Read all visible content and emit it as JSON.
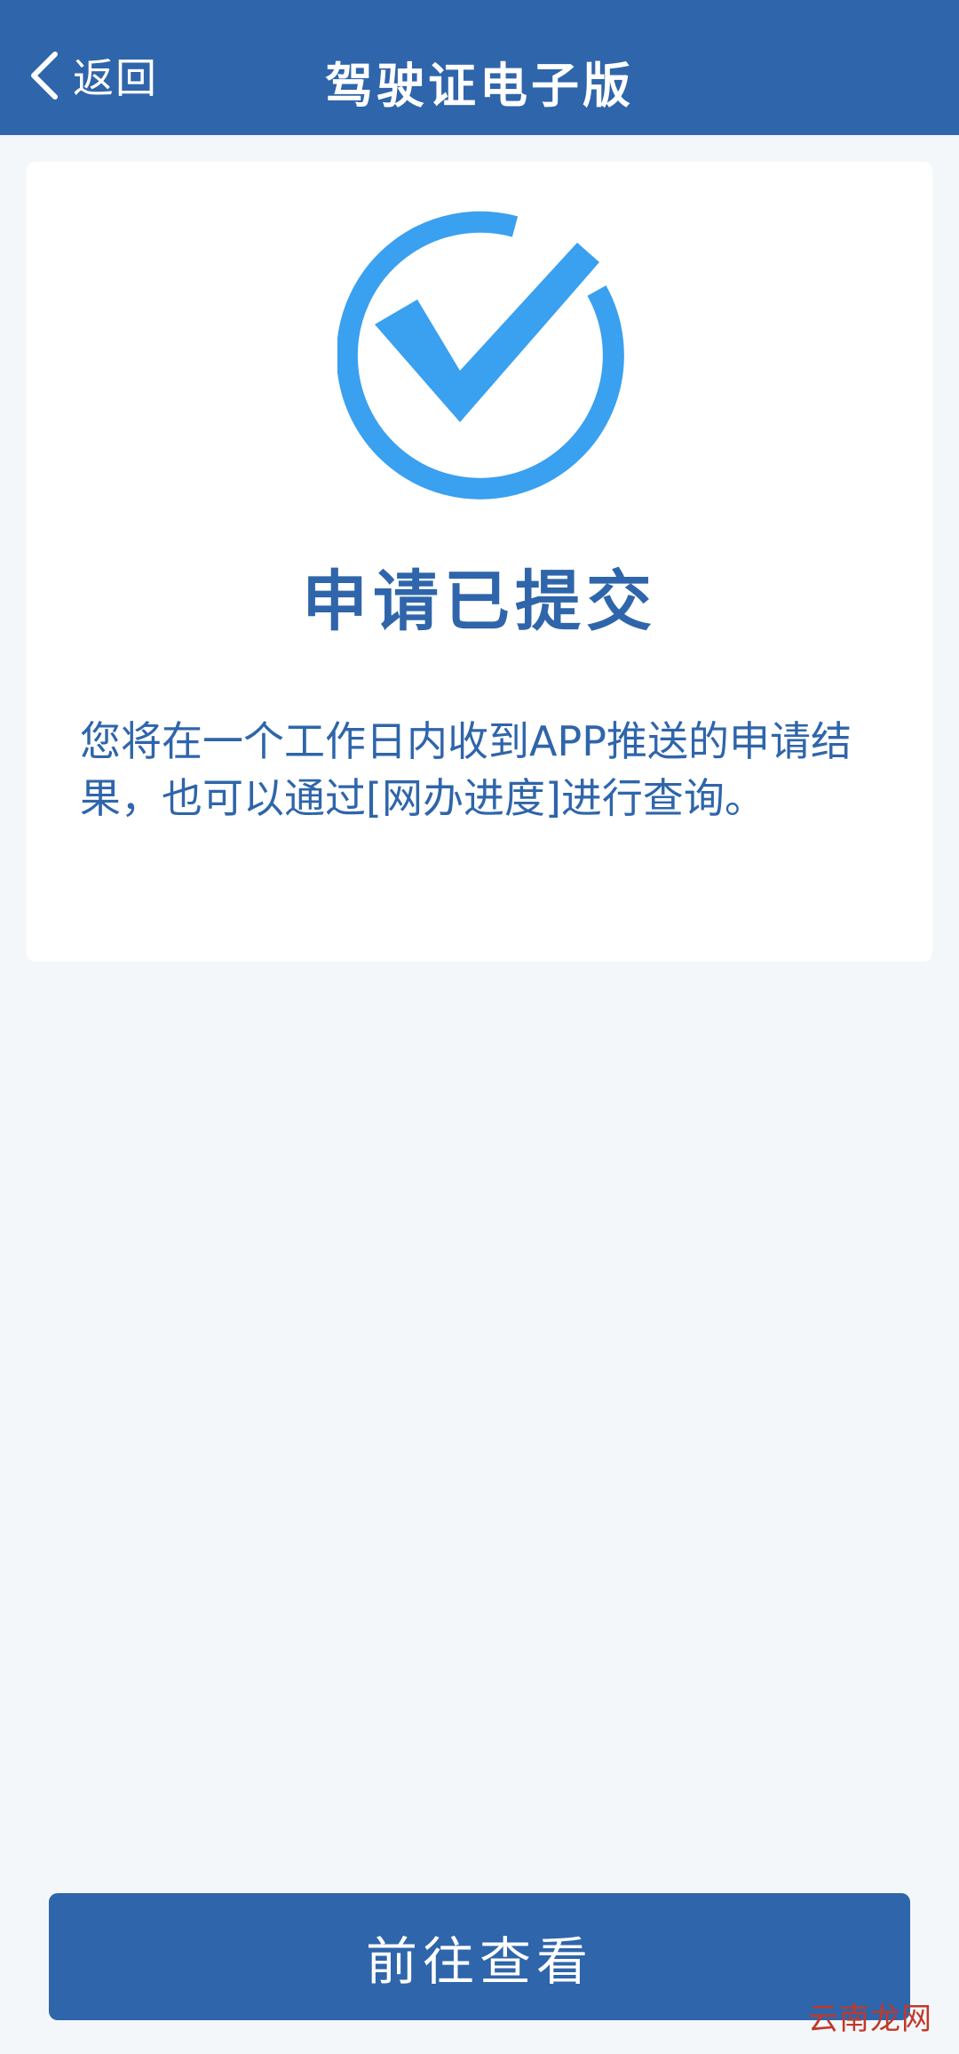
{
  "header": {
    "back_label": "返回",
    "title": "驾驶证电子版"
  },
  "result": {
    "icon": "check-circle-icon",
    "title": "申请已提交",
    "description": "您将在一个工作日内收到APP推送的申请结果，也可以通过[网办进度]进行查询。"
  },
  "actions": {
    "view_label": "前往查看"
  },
  "watermark": "云南龙网",
  "colors": {
    "primary": "#2f65aa",
    "accent": "#3aa0f0",
    "background": "#f4f7f9",
    "card": "#ffffff"
  }
}
